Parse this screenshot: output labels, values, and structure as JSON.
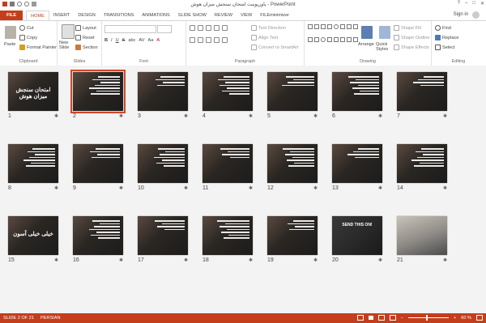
{
  "window": {
    "title": "پاورپوینت امتحان سنجش میزان هوش - PowerPoint",
    "minimize": "–",
    "maximize": "□",
    "close": "✕",
    "help": "?"
  },
  "tabs": [
    "FILE",
    "HOME",
    "INSERT",
    "DESIGN",
    "TRANSITIONS",
    "ANIMATIONS",
    "SLIDE SHOW",
    "REVIEW",
    "VIEW",
    "FILEminimizer"
  ],
  "active_tab": "HOME",
  "signin": "Sign in",
  "ribbon": {
    "clipboard": {
      "paste": "Paste",
      "cut": "Cut",
      "copy": "Copy",
      "format_painter": "Format Painter",
      "label": "Clipboard"
    },
    "slides": {
      "new_slide": "New Slide",
      "layout": "Layout",
      "reset": "Reset",
      "section": "Section",
      "label": "Slides"
    },
    "font": {
      "label": "Font",
      "bold": "B",
      "italic": "I",
      "underline": "U",
      "strike": "S",
      "shadow": "abc",
      "spacing": "AV",
      "case": "Aa",
      "color": "A"
    },
    "paragraph": {
      "label": "Paragraph",
      "text_direction": "Text Direction",
      "align_text": "Align Text",
      "convert_smartart": "Convert to SmartArt"
    },
    "drawing": {
      "label": "Drawing",
      "arrange": "Arrange",
      "quick_styles": "Quick Styles",
      "shape_fill": "Shape Fill",
      "shape_outline": "Shape Outline",
      "shape_effects": "Shape Effects"
    },
    "editing": {
      "label": "Editing",
      "find": "Find",
      "replace": "Replace",
      "select": "Select"
    }
  },
  "slides": [
    {
      "num": "1",
      "kind": "title",
      "text": "امتحان سنجش میزان هوش"
    },
    {
      "num": "2",
      "kind": "text",
      "selected": true
    },
    {
      "num": "3",
      "kind": "text"
    },
    {
      "num": "4",
      "kind": "text"
    },
    {
      "num": "5",
      "kind": "text"
    },
    {
      "num": "6",
      "kind": "text"
    },
    {
      "num": "7",
      "kind": "text"
    },
    {
      "num": "8",
      "kind": "text"
    },
    {
      "num": "9",
      "kind": "text"
    },
    {
      "num": "10",
      "kind": "text"
    },
    {
      "num": "11",
      "kind": "text"
    },
    {
      "num": "12",
      "kind": "text"
    },
    {
      "num": "13",
      "kind": "text"
    },
    {
      "num": "14",
      "kind": "text"
    },
    {
      "num": "15",
      "kind": "title",
      "text": "خیلی خیلی آسون"
    },
    {
      "num": "16",
      "kind": "text"
    },
    {
      "num": "17",
      "kind": "text"
    },
    {
      "num": "18",
      "kind": "text"
    },
    {
      "num": "19",
      "kind": "text"
    },
    {
      "num": "20",
      "kind": "send",
      "text": "SEND THIS ON!"
    },
    {
      "num": "21",
      "kind": "photo"
    }
  ],
  "status": {
    "slide_info": "SLIDE 2 OF 21",
    "language": "PERSIAN",
    "zoom": "60 %",
    "minus": "–",
    "plus": "+"
  },
  "colors": {
    "accent": "#c43e1c",
    "selection": "#d24726"
  }
}
